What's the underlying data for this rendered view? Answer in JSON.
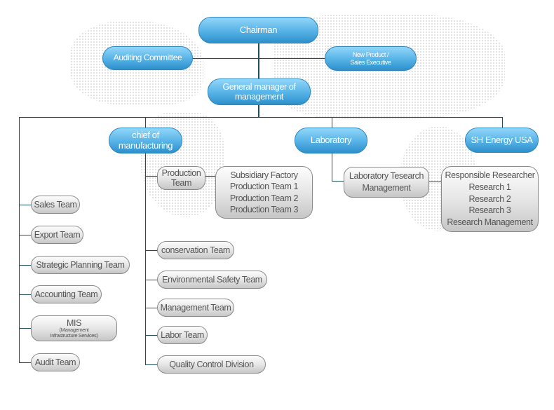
{
  "top": {
    "chairman": "Chairman",
    "auditing": "Auditing Committee",
    "new_product": [
      "New Product /",
      "Sales Executive"
    ],
    "gm": [
      "General manager of",
      "management"
    ]
  },
  "divisions": {
    "chief": [
      "chief of",
      "manufacturing"
    ],
    "laboratory": "Laboratory",
    "sh_energy": "SH Energy USA"
  },
  "left_teams": [
    "Sales Team",
    "Export Team",
    "Strategic Planning Team",
    "Accounting Team",
    "Audit Team"
  ],
  "mis": {
    "title": "MIS",
    "sub": [
      "(Management",
      "Infrastructure Services)"
    ]
  },
  "manufacturing": {
    "production": [
      "Production",
      "Team"
    ],
    "subsidiary": [
      "Subsidiary Factory",
      "Production Team 1",
      "Production Team 2",
      "Production Team 3"
    ],
    "teams": [
      "conservation Team",
      "Environmental Safety Team",
      "Management Team",
      "Labor Team",
      "Quality Control Division"
    ]
  },
  "lab": {
    "research_mgmt": [
      "Laboratory Tesearch",
      "Management"
    ],
    "researchers": [
      "Responsible Researcher",
      "Research 1",
      "Research 2",
      "Research 3",
      "Research Management"
    ]
  },
  "colors": {
    "accent_blue": "#3a9ad6",
    "line": "#1e4f5f",
    "grey_box": "#d8d8d8"
  }
}
